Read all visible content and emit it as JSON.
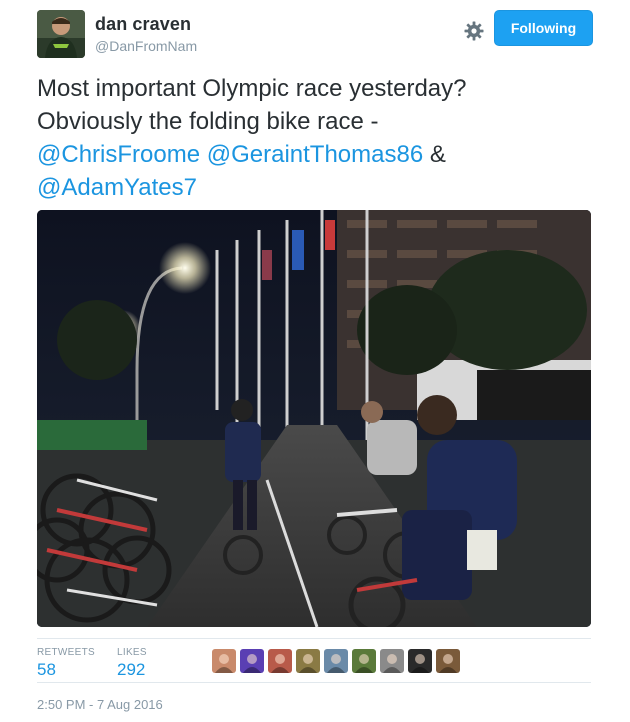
{
  "user": {
    "fullname": "dan craven",
    "screen_name": "@DanFromNam"
  },
  "follow_button": {
    "label": "Following"
  },
  "tweet": {
    "line1": "Most important Olympic race yesterday?",
    "line2": "Obviously the folding bike race -",
    "mention1": "@ChrisFroome",
    "mention2": "@GeraintThomas86",
    "amp": "&",
    "mention3": "@AdamYates7"
  },
  "stats": {
    "retweets_label": "RETWEETS",
    "retweets_value": "58",
    "likes_label": "LIKES",
    "likes_value": "292"
  },
  "likers": [
    {
      "name": "liker-1",
      "color": "#c98a6b"
    },
    {
      "name": "liker-2",
      "color": "#5a3fb3"
    },
    {
      "name": "liker-3",
      "color": "#b85a4a"
    },
    {
      "name": "liker-4",
      "color": "#8a7a44"
    },
    {
      "name": "liker-5",
      "color": "#6a8aa8"
    },
    {
      "name": "liker-6",
      "color": "#5a7a3a"
    },
    {
      "name": "liker-7",
      "color": "#8a8a8a"
    },
    {
      "name": "liker-8",
      "color": "#2a2a2a"
    },
    {
      "name": "liker-9",
      "color": "#7a5a3a"
    }
  ],
  "timestamp": "2:50 PM - 7 Aug 2016",
  "colors": {
    "accent": "#1da1f2",
    "link": "#1b95e0",
    "muted": "#8899a6"
  }
}
